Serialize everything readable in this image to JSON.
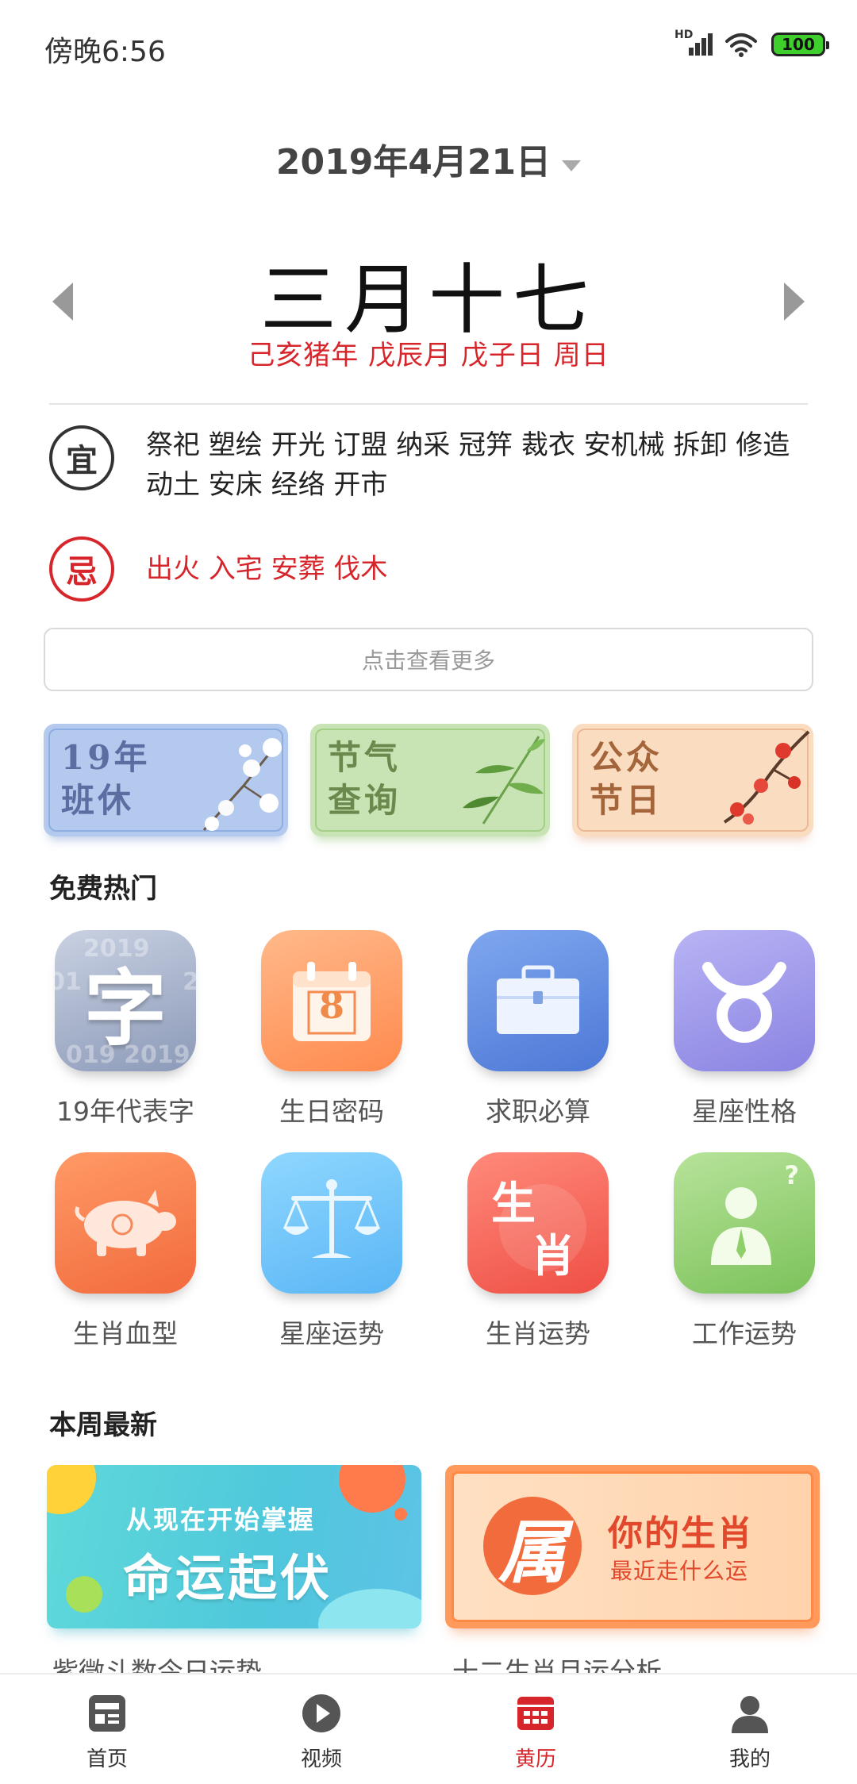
{
  "status_bar": {
    "time": "傍晚6:56",
    "signal_label": "HD",
    "battery": "100"
  },
  "date_header": {
    "date": "2019年4月21日"
  },
  "lunar": {
    "day": "三月十七",
    "ganzhi": "己亥猪年 戊辰月 戊子日 周日"
  },
  "yi": {
    "badge": "宜",
    "text": "祭祀 塑绘 开光 订盟 纳采 冠笄 裁衣 安机械 拆卸 修造 动土 安床 经络 开市"
  },
  "ji": {
    "badge": "忌",
    "text": "出火 入宅 安葬 伐木"
  },
  "more_button": "点击查看更多",
  "banners": [
    {
      "line1": "19年",
      "line2": "班休",
      "color": "#b3c9ee"
    },
    {
      "line1": "节气",
      "line2": "查询",
      "color": "#c8e3b4"
    },
    {
      "line1": "公众",
      "line2": "节日",
      "color": "#fadcc1"
    }
  ],
  "hot_section": {
    "title": "免费热门"
  },
  "hot_items": [
    {
      "label": "19年代表字",
      "icon": "character-icon",
      "glyph": "字"
    },
    {
      "label": "生日密码",
      "icon": "calendar-icon",
      "glyph": "8"
    },
    {
      "label": "求职必算",
      "icon": "briefcase-icon"
    },
    {
      "label": "星座性格",
      "icon": "taurus-icon"
    },
    {
      "label": "生肖血型",
      "icon": "pig-icon"
    },
    {
      "label": "星座运势",
      "icon": "libra-scale-icon"
    },
    {
      "label": "生肖运势",
      "icon": "zodiac-glyph-icon",
      "glyph1": "生",
      "glyph2": "肖"
    },
    {
      "label": "工作运势",
      "icon": "worker-icon",
      "glyph": "?"
    }
  ],
  "weekly_section": {
    "title": "本周最新"
  },
  "weekly_cards": [
    {
      "line1": "从现在开始掌握",
      "line2": "命运起伏",
      "caption": "紫微斗数今日运势"
    },
    {
      "glyph": "属",
      "title": "你的生肖",
      "subtitle": "最近走什么运",
      "caption": "十二生肖月运分析"
    }
  ],
  "bottom_nav": [
    {
      "label": "首页",
      "icon": "home-icon"
    },
    {
      "label": "视频",
      "icon": "play-icon"
    },
    {
      "label": "黄历",
      "icon": "almanac-icon",
      "active": true
    },
    {
      "label": "我的",
      "icon": "profile-icon"
    }
  ],
  "colors": {
    "accent": "#d7262b",
    "text": "#222222",
    "muted": "#999999"
  }
}
